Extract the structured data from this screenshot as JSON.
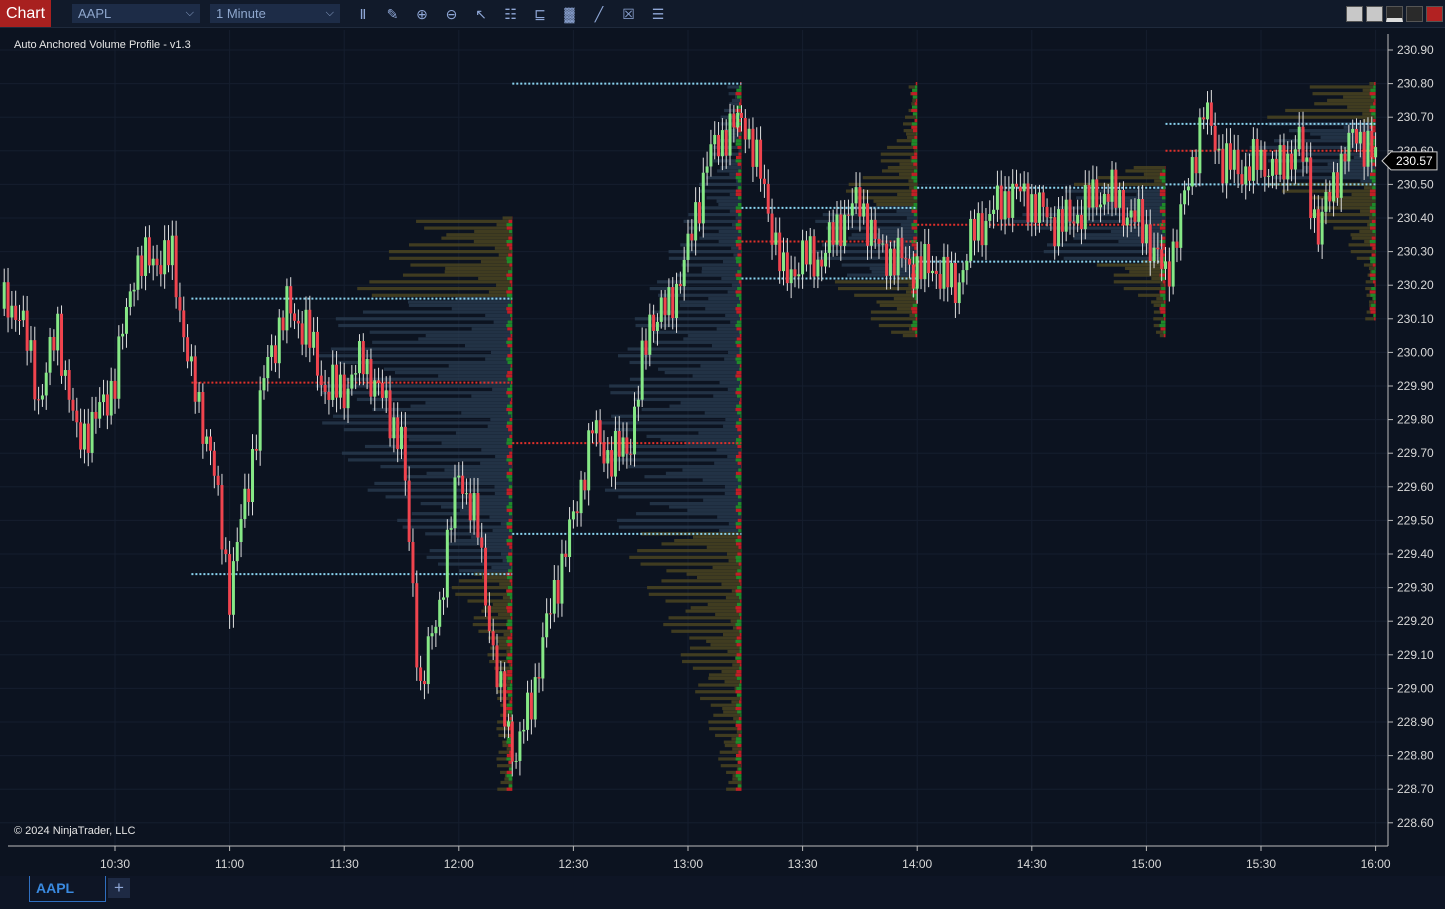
{
  "window": {
    "title": "Chart"
  },
  "toolbar": {
    "instrument": "AAPL",
    "interval": "1 Minute",
    "tools": [
      "bar-type-icon",
      "drawing-tools-icon",
      "zoom-in-icon",
      "zoom-out-icon",
      "pointer-icon",
      "data-box-icon",
      "properties-icon",
      "indicators-icon",
      "strategies-icon",
      "chart-trader-icon",
      "templates-icon"
    ]
  },
  "indicator": {
    "name": "Auto Anchored Volume Profile - v1.3"
  },
  "copyright": "© 2024 NinjaTrader, LLC",
  "tabs": [
    {
      "label": "AAPL"
    }
  ],
  "add_tab": "+",
  "colors": {
    "background": "#0c1320",
    "up_candle": "#86e886",
    "down_candle": "#f0444e",
    "wick": "#e0e0e0",
    "poc_line": "#e0302a",
    "value_area_line": "#8ad4f0",
    "profile_outside": "#4a4421",
    "profile_value_area": "#27384c",
    "delta_buy": "#1f8a2a",
    "delta_sell": "#c21e26"
  },
  "chart_data": {
    "type": "candlestick",
    "ylim": [
      228.55,
      230.95
    ],
    "y_ticks": [
      "230.90",
      "230.80",
      "230.70",
      "230.60",
      "230.50",
      "230.40",
      "230.30",
      "230.20",
      "230.10",
      "230.00",
      "229.90",
      "229.80",
      "229.70",
      "229.60",
      "229.50",
      "229.40",
      "229.30",
      "229.20",
      "229.10",
      "229.00",
      "228.90",
      "228.80",
      "228.70",
      "228.60"
    ],
    "x_ticks": [
      "10:30",
      "11:00",
      "11:30",
      "12:00",
      "12:30",
      "13:00",
      "13:30",
      "14:00",
      "14:30",
      "15:00",
      "15:30",
      "16:00"
    ],
    "last_price": "230.57",
    "closes_5min": {
      "times": [
        "10:05",
        "10:10",
        "10:15",
        "10:20",
        "10:25",
        "10:30",
        "10:35",
        "10:40",
        "10:45",
        "10:50",
        "10:55",
        "11:00",
        "11:05",
        "11:10",
        "11:15",
        "11:20",
        "11:25",
        "11:30",
        "11:35",
        "11:40",
        "11:45",
        "11:50",
        "11:55",
        "12:00",
        "12:05",
        "12:10",
        "12:15",
        "12:20",
        "12:25",
        "12:30",
        "12:35",
        "12:40",
        "12:45",
        "12:50",
        "12:55",
        "13:00",
        "13:05",
        "13:10",
        "13:15",
        "13:20",
        "13:25",
        "13:30",
        "13:35",
        "13:40",
        "13:45",
        "13:50",
        "13:55",
        "14:00",
        "14:05",
        "14:10",
        "14:15",
        "14:20",
        "14:25",
        "14:30",
        "14:35",
        "14:40",
        "14:45",
        "14:50",
        "14:55",
        "15:00",
        "15:05",
        "15:10",
        "15:15",
        "15:20",
        "15:25",
        "15:30",
        "15:35",
        "15:40",
        "15:45",
        "15:50",
        "15:55",
        "16:00"
      ],
      "values": [
        230.13,
        229.86,
        230.07,
        229.74,
        229.8,
        229.92,
        230.25,
        230.28,
        230.28,
        229.92,
        229.71,
        229.29,
        229.62,
        229.98,
        230.13,
        230.07,
        229.89,
        229.89,
        229.98,
        229.86,
        229.74,
        228.99,
        229.26,
        229.65,
        229.47,
        229.02,
        228.79,
        229.02,
        229.29,
        229.5,
        229.77,
        229.68,
        229.74,
        230.1,
        230.13,
        230.3,
        230.57,
        230.66,
        230.69,
        230.48,
        230.22,
        230.28,
        230.28,
        230.39,
        230.45,
        230.3,
        230.28,
        230.25,
        230.25,
        230.19,
        230.36,
        230.42,
        230.48,
        230.45,
        230.39,
        230.39,
        230.45,
        230.48,
        230.42,
        230.36,
        230.22,
        230.45,
        230.72,
        230.57,
        230.54,
        230.57,
        230.54,
        230.63,
        230.36,
        230.54,
        230.66,
        230.57
      ]
    },
    "volume_profiles": [
      {
        "start": "10:50",
        "end": "12:14",
        "vah": 230.16,
        "poc": 229.91,
        "val": 229.34,
        "low": 228.7,
        "high": 230.4
      },
      {
        "start": "12:14",
        "end": "13:14",
        "vah": 230.8,
        "poc": 229.73,
        "val": 229.46,
        "low": 228.7,
        "high": 230.8
      },
      {
        "start": "13:14",
        "end": "14:00",
        "vah": 230.43,
        "poc": 230.33,
        "val": 230.22,
        "low": 230.05,
        "high": 230.8
      },
      {
        "start": "14:00",
        "end": "15:05",
        "vah": 230.49,
        "poc": 230.38,
        "val": 230.27,
        "low": 230.05,
        "high": 230.55
      },
      {
        "start": "15:05",
        "end": "16:00",
        "vah": 230.68,
        "poc": 230.6,
        "val": 230.5,
        "low": 230.1,
        "high": 230.8
      }
    ]
  }
}
